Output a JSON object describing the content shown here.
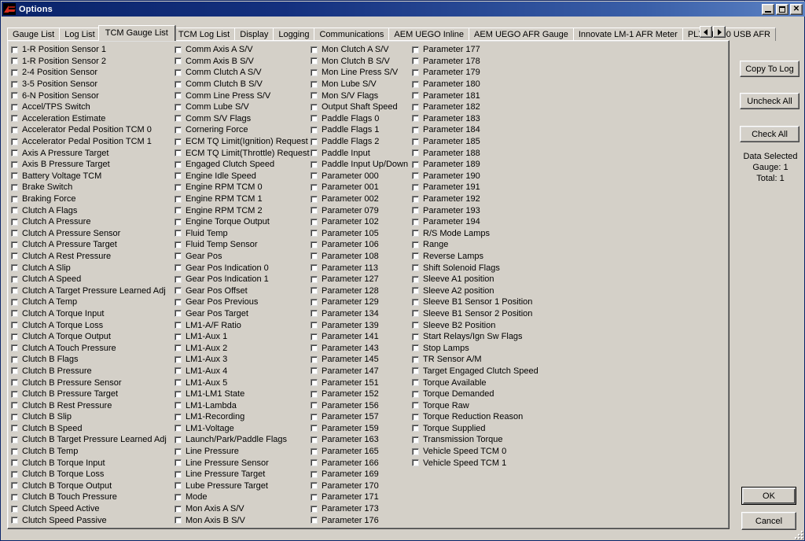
{
  "window": {
    "title": "Options",
    "icon": "aem-logo-icon",
    "controls": {
      "minimize": "minimize-icon",
      "maximize": "maximize-icon",
      "close": "close-icon"
    }
  },
  "tabs": {
    "items": [
      {
        "label": "Gauge List",
        "active": false
      },
      {
        "label": "Log List",
        "active": false
      },
      {
        "label": "TCM Gauge List",
        "active": true
      },
      {
        "label": "TCM Log List",
        "active": false
      },
      {
        "label": "Display",
        "active": false
      },
      {
        "label": "Logging",
        "active": false
      },
      {
        "label": "Communications",
        "active": false
      },
      {
        "label": "AEM UEGO Inline",
        "active": false
      },
      {
        "label": "AEM UEGO AFR Gauge",
        "active": false
      },
      {
        "label": "Innovate LM-1 AFR Meter",
        "active": false
      },
      {
        "label": "PLX M-300 USB AFR",
        "active": false
      }
    ],
    "scroll_left": "scroll-left-icon",
    "scroll_right": "scroll-right-icon"
  },
  "side_panel": {
    "copy_to_log_label": "Copy To Log",
    "uncheck_all_label": "Uncheck All",
    "check_all_label": "Check All",
    "data_selected_title": "Data Selected",
    "gauge_count": "Gauge: 1",
    "total_count": "Total: 1",
    "ok_label": "OK",
    "cancel_label": "Cancel"
  },
  "columns": [
    {
      "items": [
        {
          "label": "1-R Position Sensor 1",
          "checked": false
        },
        {
          "label": "1-R Position Sensor 2",
          "checked": false
        },
        {
          "label": "2-4 Position Sensor",
          "checked": false
        },
        {
          "label": "3-5 Position Sensor",
          "checked": false
        },
        {
          "label": "6-N Position Sensor",
          "checked": false
        },
        {
          "label": "Accel/TPS Switch",
          "checked": false
        },
        {
          "label": "Acceleration Estimate",
          "checked": false
        },
        {
          "label": "Accelerator Pedal Position TCM 0",
          "checked": false
        },
        {
          "label": "Accelerator Pedal Position TCM 1",
          "checked": false
        },
        {
          "label": "Axis A Pressure Target",
          "checked": false
        },
        {
          "label": "Axis B Pressure Target",
          "checked": false
        },
        {
          "label": "Battery Voltage TCM",
          "checked": false
        },
        {
          "label": "Brake Switch",
          "checked": false
        },
        {
          "label": "Braking Force",
          "checked": false
        },
        {
          "label": "Clutch A Flags",
          "checked": false
        },
        {
          "label": "Clutch A Pressure",
          "checked": false
        },
        {
          "label": "Clutch A Pressure Sensor",
          "checked": false
        },
        {
          "label": "Clutch A Pressure Target",
          "checked": false
        },
        {
          "label": "Clutch A Rest Pressure",
          "checked": false
        },
        {
          "label": "Clutch A Slip",
          "checked": false
        },
        {
          "label": "Clutch A Speed",
          "checked": false
        },
        {
          "label": "Clutch A Target Pressure Learned Adj",
          "checked": false
        },
        {
          "label": "Clutch A Temp",
          "checked": false
        },
        {
          "label": "Clutch A Torque Input",
          "checked": false
        },
        {
          "label": "Clutch A Torque Loss",
          "checked": false
        },
        {
          "label": "Clutch A Torque Output",
          "checked": false
        },
        {
          "label": "Clutch A Touch Pressure",
          "checked": false
        },
        {
          "label": "Clutch B Flags",
          "checked": false
        },
        {
          "label": "Clutch B Pressure",
          "checked": false
        },
        {
          "label": "Clutch B Pressure Sensor",
          "checked": false
        },
        {
          "label": "Clutch B Pressure Target",
          "checked": false
        },
        {
          "label": "Clutch B Rest Pressure",
          "checked": false
        },
        {
          "label": "Clutch B Slip",
          "checked": false
        },
        {
          "label": "Clutch B Speed",
          "checked": false
        },
        {
          "label": "Clutch B Target Pressure Learned Adj",
          "checked": false
        },
        {
          "label": "Clutch B Temp",
          "checked": false
        },
        {
          "label": "Clutch B Torque Input",
          "checked": false
        },
        {
          "label": "Clutch B Torque Loss",
          "checked": false
        },
        {
          "label": "Clutch B Torque Output",
          "checked": false
        },
        {
          "label": "Clutch B Touch Pressure",
          "checked": false
        },
        {
          "label": "Clutch Speed Active",
          "checked": false
        },
        {
          "label": "Clutch Speed Passive",
          "checked": false
        }
      ]
    },
    {
      "items": [
        {
          "label": "Comm Axis A S/V",
          "checked": false
        },
        {
          "label": "Comm Axis B S/V",
          "checked": false
        },
        {
          "label": "Comm Clutch A S/V",
          "checked": false
        },
        {
          "label": "Comm Clutch B S/V",
          "checked": false
        },
        {
          "label": "Comm Line Press S/V",
          "checked": false
        },
        {
          "label": "Comm Lube S/V",
          "checked": false
        },
        {
          "label": "Comm S/V Flags",
          "checked": false
        },
        {
          "label": "Cornering Force",
          "checked": false
        },
        {
          "label": "ECM TQ Limit(Ignition) Request",
          "checked": false
        },
        {
          "label": "ECM TQ Limit(Throttle) Request",
          "checked": false
        },
        {
          "label": "Engaged Clutch Speed",
          "checked": false
        },
        {
          "label": "Engine Idle Speed",
          "checked": false
        },
        {
          "label": "Engine RPM TCM 0",
          "checked": false
        },
        {
          "label": "Engine RPM TCM 1",
          "checked": false
        },
        {
          "label": "Engine RPM TCM 2",
          "checked": false
        },
        {
          "label": "Engine Torque Output",
          "checked": false
        },
        {
          "label": "Fluid Temp",
          "checked": false
        },
        {
          "label": "Fluid Temp Sensor",
          "checked": false
        },
        {
          "label": "Gear Pos",
          "checked": false
        },
        {
          "label": "Gear Pos Indication 0",
          "checked": false
        },
        {
          "label": "Gear Pos Indication 1",
          "checked": false
        },
        {
          "label": "Gear Pos Offset",
          "checked": false
        },
        {
          "label": "Gear Pos Previous",
          "checked": false
        },
        {
          "label": "Gear Pos Target",
          "checked": false
        },
        {
          "label": "LM1-A/F Ratio",
          "checked": false
        },
        {
          "label": "LM1-Aux 1",
          "checked": false
        },
        {
          "label": "LM1-Aux 2",
          "checked": false
        },
        {
          "label": "LM1-Aux 3",
          "checked": false
        },
        {
          "label": "LM1-Aux 4",
          "checked": false
        },
        {
          "label": "LM1-Aux 5",
          "checked": false
        },
        {
          "label": "LM1-LM1 State",
          "checked": false
        },
        {
          "label": "LM1-Lambda",
          "checked": false
        },
        {
          "label": "LM1-Recording",
          "checked": false
        },
        {
          "label": "LM1-Voltage",
          "checked": false
        },
        {
          "label": "Launch/Park/Paddle Flags",
          "checked": false
        },
        {
          "label": "Line Pressure",
          "checked": false
        },
        {
          "label": "Line Pressure Sensor",
          "checked": false
        },
        {
          "label": "Line Pressure Target",
          "checked": false
        },
        {
          "label": "Lube Pressure Target",
          "checked": false
        },
        {
          "label": "Mode",
          "checked": false
        },
        {
          "label": "Mon Axis A S/V",
          "checked": false
        },
        {
          "label": "Mon Axis B S/V",
          "checked": false
        }
      ]
    },
    {
      "items": [
        {
          "label": "Mon Clutch A S/V",
          "checked": false
        },
        {
          "label": "Mon Clutch B S/V",
          "checked": false
        },
        {
          "label": "Mon Line Press S/V",
          "checked": false
        },
        {
          "label": "Mon Lube S/V",
          "checked": false
        },
        {
          "label": "Mon S/V Flags",
          "checked": false
        },
        {
          "label": "Output Shaft Speed",
          "checked": false
        },
        {
          "label": "Paddle Flags 0",
          "checked": false
        },
        {
          "label": "Paddle Flags 1",
          "checked": false
        },
        {
          "label": "Paddle Flags 2",
          "checked": false
        },
        {
          "label": "Paddle Input",
          "checked": false
        },
        {
          "label": "Paddle Input Up/Down",
          "checked": false
        },
        {
          "label": "Parameter 000",
          "checked": false
        },
        {
          "label": "Parameter 001",
          "checked": false
        },
        {
          "label": "Parameter 002",
          "checked": false
        },
        {
          "label": "Parameter 079",
          "checked": false
        },
        {
          "label": "Parameter 102",
          "checked": false
        },
        {
          "label": "Parameter 105",
          "checked": false
        },
        {
          "label": "Parameter 106",
          "checked": false
        },
        {
          "label": "Parameter 108",
          "checked": false
        },
        {
          "label": "Parameter 113",
          "checked": false
        },
        {
          "label": "Parameter 127",
          "checked": false
        },
        {
          "label": "Parameter 128",
          "checked": false
        },
        {
          "label": "Parameter 129",
          "checked": false
        },
        {
          "label": "Parameter 134",
          "checked": false
        },
        {
          "label": "Parameter 139",
          "checked": false
        },
        {
          "label": "Parameter 141",
          "checked": false
        },
        {
          "label": "Parameter 143",
          "checked": false
        },
        {
          "label": "Parameter 145",
          "checked": false
        },
        {
          "label": "Parameter 147",
          "checked": false
        },
        {
          "label": "Parameter 151",
          "checked": false
        },
        {
          "label": "Parameter 152",
          "checked": false
        },
        {
          "label": "Parameter 156",
          "checked": false
        },
        {
          "label": "Parameter 157",
          "checked": false
        },
        {
          "label": "Parameter 159",
          "checked": false
        },
        {
          "label": "Parameter 163",
          "checked": false
        },
        {
          "label": "Parameter 165",
          "checked": false
        },
        {
          "label": "Parameter 166",
          "checked": false
        },
        {
          "label": "Parameter 169",
          "checked": false
        },
        {
          "label": "Parameter 170",
          "checked": false
        },
        {
          "label": "Parameter 171",
          "checked": false
        },
        {
          "label": "Parameter 173",
          "checked": false
        },
        {
          "label": "Parameter 176",
          "checked": false
        }
      ]
    },
    {
      "items": [
        {
          "label": "Parameter 177",
          "checked": false
        },
        {
          "label": "Parameter 178",
          "checked": false
        },
        {
          "label": "Parameter 179",
          "checked": false
        },
        {
          "label": "Parameter 180",
          "checked": false
        },
        {
          "label": "Parameter 181",
          "checked": false
        },
        {
          "label": "Parameter 182",
          "checked": false
        },
        {
          "label": "Parameter 183",
          "checked": false
        },
        {
          "label": "Parameter 184",
          "checked": false
        },
        {
          "label": "Parameter 185",
          "checked": false
        },
        {
          "label": "Parameter 188",
          "checked": false
        },
        {
          "label": "Parameter 189",
          "checked": false
        },
        {
          "label": "Parameter 190",
          "checked": false
        },
        {
          "label": "Parameter 191",
          "checked": false
        },
        {
          "label": "Parameter 192",
          "checked": false
        },
        {
          "label": "Parameter 193",
          "checked": false
        },
        {
          "label": "Parameter 194",
          "checked": false
        },
        {
          "label": "R/S Mode Lamps",
          "checked": false
        },
        {
          "label": "Range",
          "checked": false
        },
        {
          "label": "Reverse Lamps",
          "checked": false
        },
        {
          "label": "Shift Solenoid Flags",
          "checked": false
        },
        {
          "label": "Sleeve A1 position",
          "checked": false
        },
        {
          "label": "Sleeve A2 position",
          "checked": false
        },
        {
          "label": "Sleeve B1 Sensor 1 Position",
          "checked": false
        },
        {
          "label": "Sleeve B1 Sensor 2 Position",
          "checked": false
        },
        {
          "label": "Sleeve B2 Position",
          "checked": false
        },
        {
          "label": "Start Relays/Ign Sw Flags",
          "checked": false
        },
        {
          "label": "Stop Lamps",
          "checked": false
        },
        {
          "label": "TR Sensor A/M",
          "checked": false
        },
        {
          "label": "Target Engaged Clutch Speed",
          "checked": false
        },
        {
          "label": "Torque Available",
          "checked": false
        },
        {
          "label": "Torque Demanded",
          "checked": false
        },
        {
          "label": "Torque Raw",
          "checked": false
        },
        {
          "label": "Torque Reduction Reason",
          "checked": false
        },
        {
          "label": "Torque Supplied",
          "checked": false
        },
        {
          "label": "Transmission Torque",
          "checked": false
        },
        {
          "label": "Vehicle Speed TCM 0",
          "checked": false
        },
        {
          "label": "Vehicle Speed TCM 1",
          "checked": false
        }
      ]
    }
  ]
}
